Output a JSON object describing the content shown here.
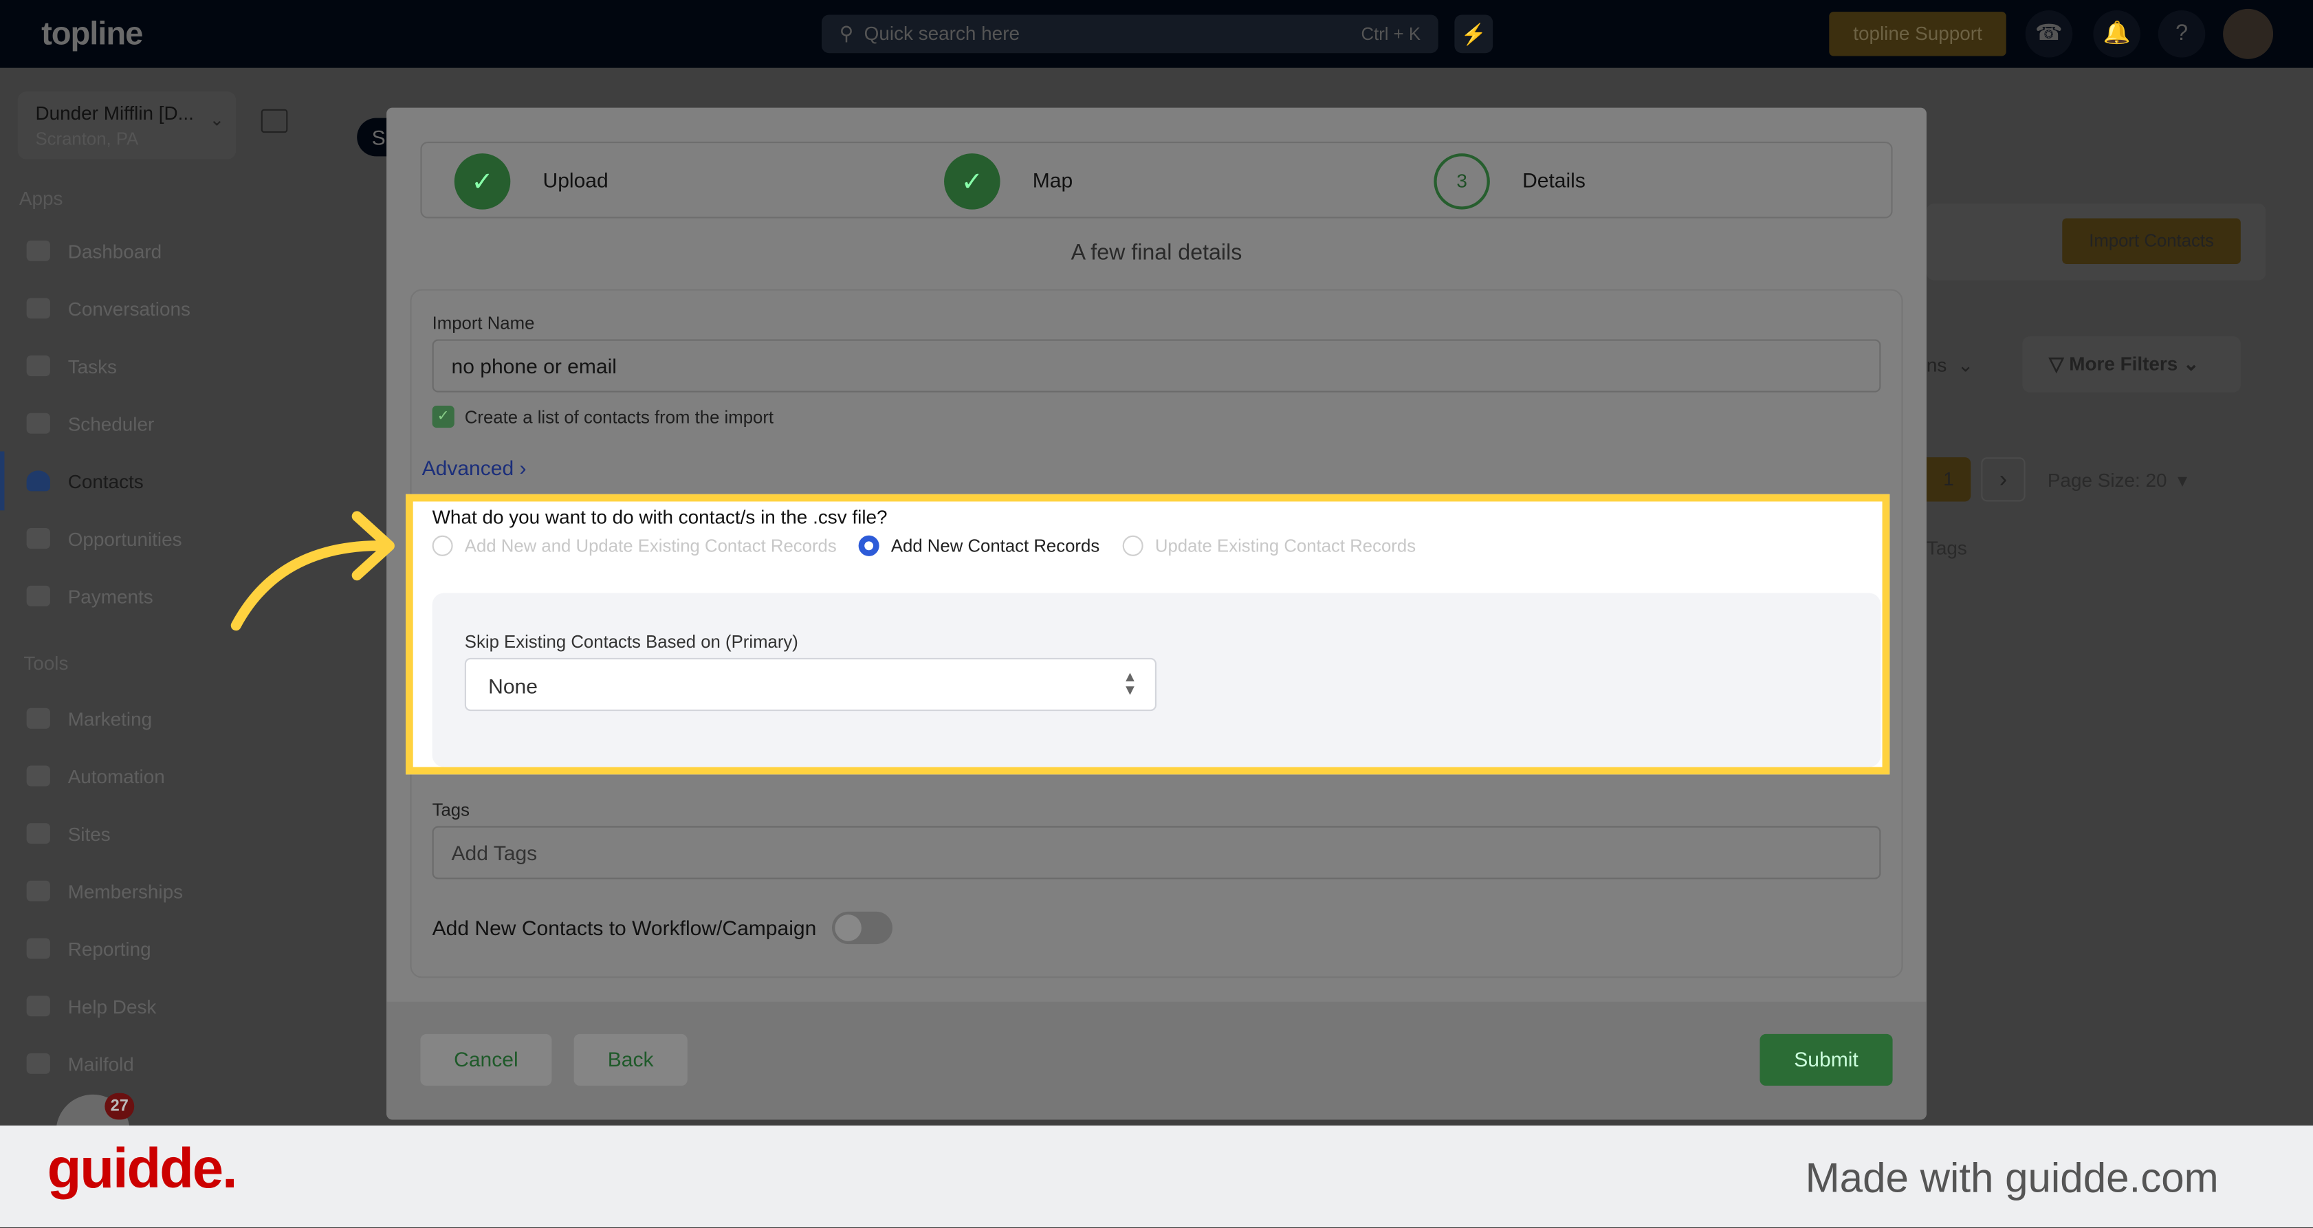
{
  "topbar": {
    "logo": "topline",
    "search_placeholder": "Quick search here",
    "search_shortcut": "Ctrl + K",
    "support_label": "topline Support",
    "icons": [
      "bolt-icon",
      "phone-icon",
      "bell-icon",
      "help-icon",
      "avatar"
    ]
  },
  "sidebar": {
    "account_name": "Dunder Mifflin [D...",
    "account_location": "Scranton, PA",
    "apps_label": "Apps",
    "apps": [
      {
        "label": "Dashboard"
      },
      {
        "label": "Conversations"
      },
      {
        "label": "Tasks"
      },
      {
        "label": "Scheduler"
      },
      {
        "label": "Contacts",
        "active": true
      },
      {
        "label": "Opportunities"
      },
      {
        "label": "Payments"
      }
    ],
    "tools_label": "Tools",
    "tools": [
      {
        "label": "Marketing"
      },
      {
        "label": "Automation"
      },
      {
        "label": "Sites"
      },
      {
        "label": "Memberships"
      },
      {
        "label": "Reporting"
      },
      {
        "label": "Help Desk"
      },
      {
        "label": "Mailfold"
      }
    ],
    "badge_count": "27"
  },
  "background": {
    "import_contacts": "Import Contacts",
    "columns_fragment": "ns",
    "more_filters": "More Filters",
    "page_number": "1",
    "page_size": "Page Size: 20",
    "tags_fragment": "Tags",
    "tab_fragment": "S"
  },
  "modal": {
    "steps": [
      {
        "label": "Upload",
        "status": "done"
      },
      {
        "label": "Map",
        "status": "done"
      },
      {
        "label": "Details",
        "number": "3",
        "status": "current"
      }
    ],
    "subtitle": "A few final details",
    "import_name_label": "Import Name",
    "import_name_value": "no phone or email",
    "create_list_label": "Create a list of contacts from the import",
    "create_list_checked": true,
    "advanced_label": "Advanced",
    "question": "What do you want to do with contact/s in the .csv file?",
    "options": [
      {
        "label": "Add New and Update Existing Contact Records",
        "selected": false
      },
      {
        "label": "Add New Contact Records",
        "selected": true
      },
      {
        "label": "Update Existing Contact Records",
        "selected": false
      }
    ],
    "skip_label": "Skip Existing Contacts Based on (Primary)",
    "skip_value": "None",
    "tags_label": "Tags",
    "tags_placeholder": "Add Tags",
    "workflow_label": "Add New Contacts to Workflow/Campaign",
    "workflow_enabled": false,
    "cancel": "Cancel",
    "back": "Back",
    "submit": "Submit"
  },
  "colors": {
    "highlight": "#ffd23f",
    "primary_green": "#2b6c35",
    "radio_blue": "#2d5bd8",
    "guidde_red": "#cc0000"
  },
  "watermark": {
    "logo": "guidde.",
    "text": "Made with guidde.com"
  }
}
